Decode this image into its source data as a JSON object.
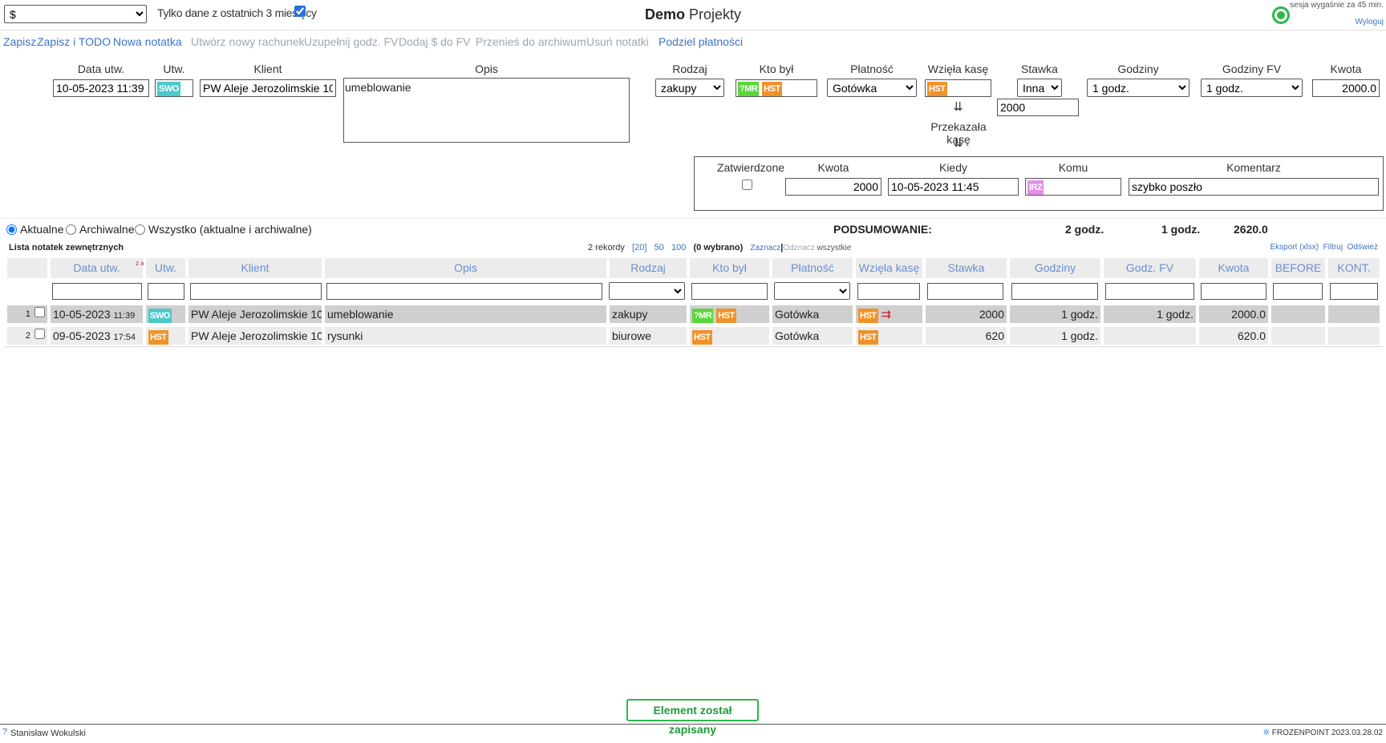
{
  "header": {
    "currency_select": "$",
    "filter_label": "Tylko dane z ostatnich 3 miesięcy",
    "filter_checked": true,
    "title_bold": "Demo",
    "title_rest": "Projekty",
    "session_text": "sesja wygaśnie za 45 min.",
    "logout": "Wyloguj",
    "status_color": "#2db84a"
  },
  "toolbar": {
    "save": "Zapisz",
    "save_todo": "Zapisz i TODO",
    "new_note": "Nowa notatka",
    "new_invoice": "Utwórz nowy rachunek",
    "fill_hours": "Uzupełnij godz. FV",
    "add_money": "Dodaj $ do FV",
    "archive": "Przenieś do archiwum",
    "delete": "Usuń notatki",
    "split_payment": "Podziel płatności"
  },
  "form": {
    "labels": {
      "date": "Data utw.",
      "created_by": "Utw.",
      "client": "Klient",
      "description": "Opis",
      "type": "Rodzaj",
      "who": "Kto był",
      "payment": "Płatność",
      "took_cash": "Wzięła kasę",
      "rate": "Stawka",
      "hours": "Godziny",
      "hours_fv": "Godziny FV",
      "amount": "Kwota",
      "passed_cash": "Przekazała kasę",
      "arrows": "⇊"
    },
    "values": {
      "date": "10-05-2023 11:39",
      "created_by": "SWO",
      "client": "PW Aleje Jerozolimskie 10",
      "description": "umeblowanie",
      "type": "zakupy",
      "who": [
        "?MR",
        "HST"
      ],
      "payment": "Gotówka",
      "took_cash": "HST",
      "rate_select": "Inna",
      "rate_value": "2000",
      "hours": "1 godz.",
      "hours_fv": "1 godz.",
      "amount": "2000.0"
    },
    "transfer": {
      "labels": {
        "approved": "Zatwierdzone",
        "amount": "Kwota",
        "when": "Kiedy",
        "to_whom": "Komu",
        "comment": "Komentarz"
      },
      "approved": false,
      "amount": "2000",
      "when": "10-05-2023 11:45",
      "to_whom": "IRZ",
      "comment": "szybko poszło"
    }
  },
  "scope": {
    "current": "Aktualne",
    "archived": "Archiwalne",
    "all": "Wszystko (aktualne i archiwalne)",
    "selected": "current"
  },
  "summary": {
    "label": "PODSUMOWANIE:",
    "hours": "2 godz.",
    "hours_fv": "1 godz.",
    "amount": "2620.0"
  },
  "list": {
    "title": "Lista notatek zewnętrznych",
    "records": "2 rekordy",
    "page_sizes": [
      "[20]",
      "50",
      "100"
    ],
    "selected_count": "(0 wybrano)",
    "select_all": "Zaznacz",
    "deselect_prefix": "Odznacz",
    "deselect_suffix": " wszystkie",
    "export": "Eksport (xlsx)",
    "filter": "Filtruj",
    "refresh": "Odśwież",
    "sort_marker": "z a",
    "columns": [
      "Data utw.",
      "Utw.",
      "Klient",
      "Opis",
      "Rodzaj",
      "Kto był",
      "Płatność",
      "Wzięła kasę",
      "Stawka",
      "Godziny",
      "Godz. FV",
      "Kwota",
      "BEFORE",
      "KONT."
    ],
    "rows": [
      {
        "num": "1",
        "date": "10-05-2023",
        "time": "11:39",
        "created_by": "SWO",
        "client": "PW Aleje Jerozolimskie 10",
        "description": "umeblowanie",
        "type": "zakupy",
        "who": [
          "?MR",
          "HST"
        ],
        "payment": "Gotówka",
        "took_cash": "HST",
        "transfer_arrow": "⇉",
        "rate": "2000",
        "hours": "1 godz.",
        "hours_fv": "1 godz.",
        "amount": "2000.0"
      },
      {
        "num": "2",
        "date": "09-05-2023",
        "time": "17:54",
        "created_by": "HST",
        "client": "PW Aleje Jerozolimskie 10",
        "description": "rysunki",
        "type": "biurowe",
        "who": [
          "HST"
        ],
        "payment": "Gotówka",
        "took_cash": "HST",
        "rate": "620",
        "hours": "1 godz.",
        "hours_fv": "",
        "amount": "620.0"
      }
    ]
  },
  "notification": "Element został zapisany",
  "footer": {
    "help": "?",
    "user": "Stanisław Wokulski",
    "version": "FROZENPOINT 2023.03.28.02"
  }
}
